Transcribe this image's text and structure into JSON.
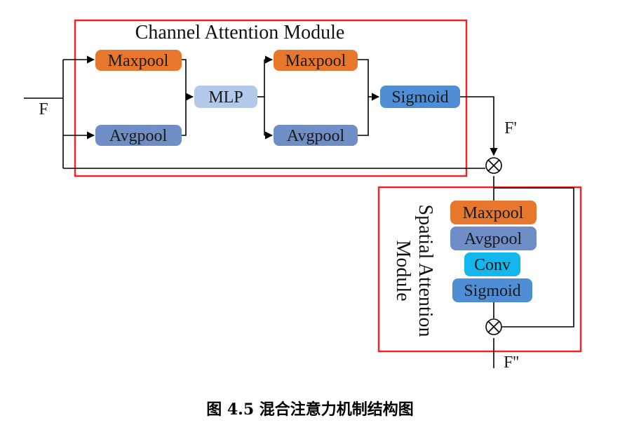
{
  "caption": "图 4.5  混合注意力机制结构图",
  "colors": {
    "frame": "#e8262b",
    "maxpool": "#e8772e",
    "avgpool": "#6f8ec6",
    "mlp": "#b3c9ea",
    "sigmoid": "#4f8dd4",
    "conv": "#14b6ee",
    "line": "#000000"
  },
  "channel_module": {
    "title": "Channel Attention Module",
    "maxpool_1": "Maxpool",
    "avgpool_1": "Avgpool",
    "mlp": "MLP",
    "maxpool_2": "Maxpool",
    "avgpool_2": "Avgpool",
    "sigmoid": "Sigmoid"
  },
  "spatial_module": {
    "title_line1": "Spatial Attention",
    "title_line2": "Module",
    "maxpool": "Maxpool",
    "avgpool": "Avgpool",
    "conv": "Conv",
    "sigmoid": "Sigmoid"
  },
  "labels": {
    "input": "F",
    "intermediate": "F'",
    "output": "F''"
  },
  "operators": {
    "multiply": "×"
  }
}
